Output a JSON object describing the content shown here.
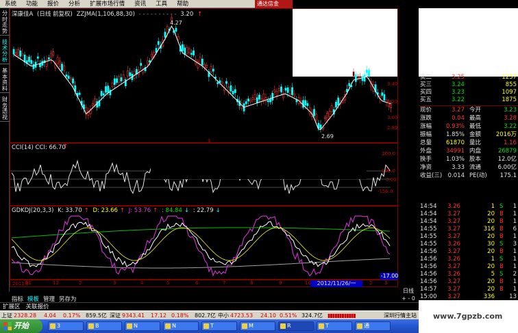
{
  "menu": [
    "系统",
    "功能",
    "报价",
    "分析",
    "扩展市场行情",
    "资讯",
    "工具",
    "帮助"
  ],
  "brand": "通达信金",
  "left_tabs": [
    "分时走势",
    "技术分析",
    "基本资料",
    "财务透视"
  ],
  "main_panel": {
    "title_name": "深康佳A",
    "title_period": "(日线 前复权)",
    "title_ind": "ZZJMA(1,106,88,30)",
    "title_dots": "- - - - - - - - - -",
    "title_value": "3.20",
    "high_label": "4.27",
    "low_label": "2.69",
    "price_ticks": [
      "3.40",
      "3.20",
      "3.00",
      "2.89"
    ],
    "marker": "$"
  },
  "cci_panel": {
    "title": "CCI(14) CCI: 66.70",
    "ticks": [
      "300.0",
      "100.0",
      "0.00",
      "-150.0"
    ]
  },
  "kdj_panel": {
    "title_name": "GDKDJ(20,3,3)",
    "k": "K: 33.70",
    "d": "D: 23.66",
    "j": "J: 53.76",
    "v4": ": 84.84",
    "v5": ": 22.79",
    "low_value": "-17.00"
  },
  "x_axis": {
    "year": "2011年",
    "ticks": [
      "11",
      "12",
      "2",
      "3",
      "4",
      "5",
      "6",
      "7",
      "8",
      "9",
      "10",
      "11",
      "12",
      "2",
      "3"
    ],
    "cursor_date": "2012/11/26/一"
  },
  "side_labels": {
    "date": "日线",
    "zoom_plus": "+",
    "zoom_minus": "-",
    "zoom_other": "0"
  },
  "chart_tabs": [
    "指标",
    "模板",
    "管理",
    "另存为"
  ],
  "ext_bar": [
    "扩展区",
    "关联报价"
  ],
  "quote": {
    "sell_partial": "卖二",
    "sell_partial_price": "3.25",
    "sell_partial_vol": "1237",
    "rows_orders": [
      {
        "label": "买三",
        "price": "3.24",
        "vol": "855"
      },
      {
        "label": "买四",
        "price": "3.23",
        "vol": "1097"
      },
      {
        "label": "买五",
        "price": "3.22",
        "vol": "1875"
      }
    ],
    "stats": [
      {
        "l1": "现价",
        "v1": "3.27",
        "l2": "今开",
        "v2": "3.23"
      },
      {
        "l1": "涨跌",
        "v1": "0.04",
        "l2": "最高",
        "v2": "3.28"
      },
      {
        "l1": "涨幅",
        "v1": "0.93%",
        "l2": "最低",
        "v2": "3.22"
      },
      {
        "l1": "振幅",
        "v1": "1.85%",
        "l2": "金额",
        "v2": "2016万"
      },
      {
        "l1": "总量",
        "v1": "61870",
        "l2": "量比",
        "v2": "1.16"
      },
      {
        "l1": "外盘",
        "v1": "34991",
        "l2": "内盘",
        "v2": "26879"
      },
      {
        "l1": "换手",
        "v1": "1.03%",
        "l2": "股本",
        "v2": "12.0亿"
      },
      {
        "l1": "净资",
        "v1": "3.33",
        "l2": "流通",
        "v2": "6.00亿"
      },
      {
        "l1": "收益(三)",
        "v1": "0.014",
        "l2": "PE(动)",
        "v2": "175.1"
      }
    ]
  },
  "ticks_list": [
    {
      "t": "14:54",
      "p": "3.26",
      "v": "1",
      "s": "S",
      "n": "1"
    },
    {
      "t": "14:54",
      "p": "3.27",
      "v": "20",
      "s": "B",
      "n": "1"
    },
    {
      "t": "14:54",
      "p": "3.27",
      "v": "20",
      "s": "B",
      "n": "1"
    },
    {
      "t": "14:55",
      "p": "3.27",
      "v": "316",
      "s": "B",
      "n": "6"
    },
    {
      "t": "14:55",
      "p": "3.27",
      "v": "20",
      "s": "B",
      "n": "1"
    },
    {
      "t": "14:55",
      "p": "3.26",
      "v": "30",
      "s": "S",
      "n": "3"
    },
    {
      "t": "14:56",
      "p": "3.27",
      "v": "20",
      "s": "B",
      "n": "1"
    },
    {
      "t": "14:56",
      "p": "3.26",
      "v": "1",
      "s": "S",
      "n": "1"
    },
    {
      "t": "14:56",
      "p": "3.27",
      "v": "20",
      "s": "B",
      "n": "1"
    },
    {
      "t": "14:56",
      "p": "3.26",
      "v": "5",
      "s": "S",
      "n": "2"
    },
    {
      "t": "14:56",
      "p": "3.27",
      "v": "20",
      "s": "B",
      "n": "1"
    },
    {
      "t": "14:57",
      "p": "3.27",
      "v": "20",
      "s": "B",
      "n": "1"
    },
    {
      "t": "15:00",
      "p": "3.27",
      "v": "336",
      "s": "",
      "n": "13"
    }
  ],
  "status_bar": {
    "sh_label": "上证",
    "sh_value": "2328.28",
    "sh_chg": "4.04",
    "sh_pct": "0.17%",
    "sh_amt": "859.5亿",
    "sz_label": "深证",
    "sz_value": "9343.41",
    "sz_chg": "17.12",
    "sz_pct": "0.18%",
    "sz_amt": "802.7亿",
    "zx_label": "中小",
    "zx_value": "4723.53",
    "zx_chg": "24.10",
    "zx_pct": "0.51%",
    "zx_amt": "324.7亿",
    "right": "深圳行情主站"
  },
  "taskbar": {
    "start": "开始",
    "tasks": [
      "3",
      "B",
      "N",
      "N",
      "T",
      "M",
      "R",
      "T",
      "通"
    ]
  },
  "watermark": "www.7gpzb.com",
  "colors": {
    "up": "#ff3030",
    "down": "#00ffff",
    "yellow": "#ffff00",
    "green": "#00e000",
    "magenta": "#d040d0",
    "white": "#e0e0e0"
  }
}
